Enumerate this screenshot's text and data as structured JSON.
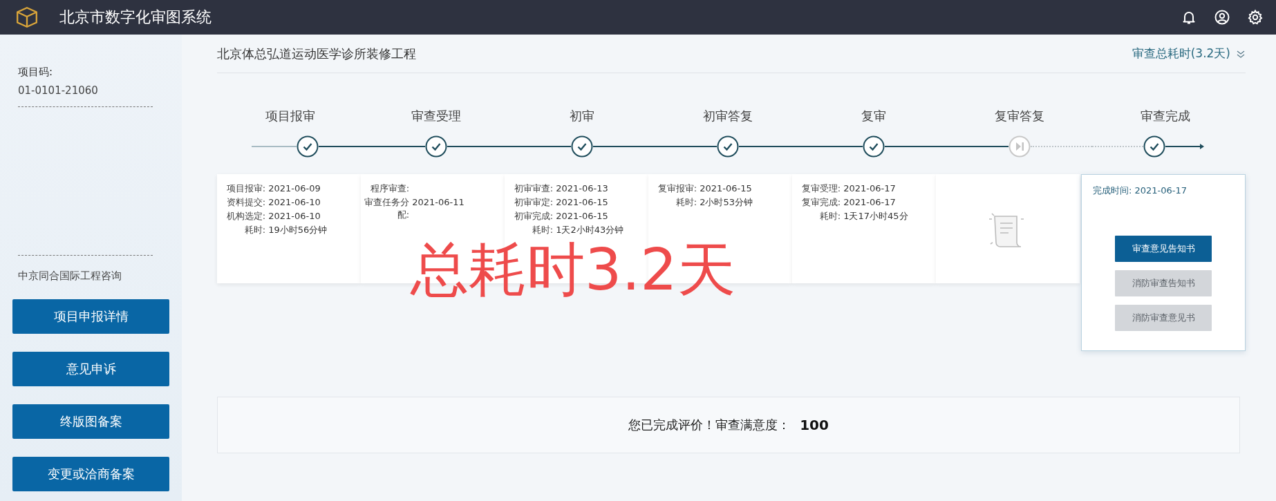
{
  "header": {
    "title": "北京市数字化审图系统"
  },
  "sidebar": {
    "code_label": "项目码:",
    "code_value": "01-0101-21060",
    "agency": "中京同合国际工程咨询",
    "buttons": [
      "项目申报详情",
      "意见申诉",
      "终版图备案",
      "变更或洽商备案"
    ]
  },
  "project": {
    "title": "北京体总弘道运动医学诊所装修工程",
    "total_time": "审查总耗时(3.2天)"
  },
  "steps": [
    {
      "label": "项目报审",
      "kind": "done"
    },
    {
      "label": "审查受理",
      "kind": "done"
    },
    {
      "label": "初审",
      "kind": "done"
    },
    {
      "label": "初审答复",
      "kind": "done"
    },
    {
      "label": "复审",
      "kind": "done"
    },
    {
      "label": "复审答复",
      "kind": "skipped"
    },
    {
      "label": "审查完成",
      "kind": "done"
    }
  ],
  "cards": [
    {
      "kind": "details",
      "rows": [
        {
          "label": "项目报审:",
          "value": "2021-06-09"
        },
        {
          "label": "资料提交:",
          "value": "2021-06-10"
        },
        {
          "label": "机构选定:",
          "value": "2021-06-10"
        },
        {
          "label": "耗时:",
          "value": "19小时56分钟"
        }
      ]
    },
    {
      "kind": "details",
      "rows": [
        {
          "label": "程序审查:"
        },
        {
          "label": "审查任务分配:",
          "value": "2021-06-11"
        }
      ]
    },
    {
      "kind": "details",
      "rows": [
        {
          "label": "初审审查:",
          "value": "2021-06-13"
        },
        {
          "label": "初审审定:",
          "value": "2021-06-15"
        },
        {
          "label": "初审完成:",
          "value": "2021-06-15"
        },
        {
          "label": "耗时:",
          "value": "1天2小时43分钟"
        }
      ]
    },
    {
      "kind": "details",
      "rows": [
        {
          "label": "复审报审:",
          "value": "2021-06-15"
        },
        {
          "label": "耗时:",
          "value": "2小时53分钟"
        }
      ]
    },
    {
      "kind": "details",
      "rows": [
        {
          "label": "复审受理:",
          "value": "2021-06-17"
        },
        {
          "label": "复审完成:",
          "value": "2021-06-17"
        },
        {
          "label": "耗时:",
          "value": "1天17小时45分"
        }
      ]
    },
    {
      "kind": "empty"
    }
  ],
  "completion": {
    "label": "完成时间:",
    "value": "2021-06-17",
    "buttons": [
      {
        "label": "审查意见告知书",
        "disabled": false
      },
      {
        "label": "消防审查告知书",
        "disabled": true
      },
      {
        "label": "消防审查意见书",
        "disabled": true
      }
    ]
  },
  "rating": {
    "text": "您已完成评价！审查满意度：",
    "score": "100"
  },
  "annotation": "总耗时3.2天"
}
